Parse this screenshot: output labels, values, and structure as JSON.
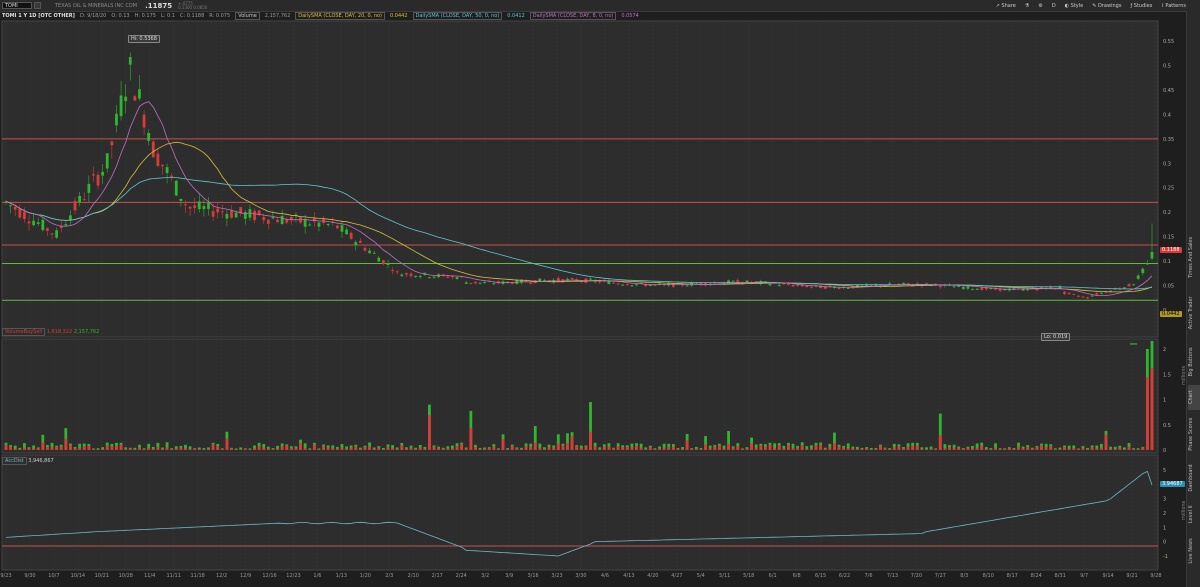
{
  "symbol": "TOMI",
  "company": "TEXAS OIL & MINERALS INC COM",
  "last_price": ".11875",
  "bid_ask": [
    "+.0775",
    "0.1300",
    "0.0850"
  ],
  "toolbar": {
    "share": "Share",
    "interval": "D",
    "style": "Style",
    "drawings": "Drawings",
    "studies": "Studies",
    "patterns": "Patterns"
  },
  "info": {
    "title": "TOMI 1 Y 1D [OTC OTHER]",
    "date": "D: 9/18/20",
    "open": "O: 0.13",
    "high": "H: 0.175",
    "low": "L: 0.1",
    "close": "C: 0.1188",
    "range": "R: 0.075",
    "volume_label": "Volume",
    "volume": "2,157,762",
    "sma20_label": "DailySMA (CLOSE, DAY, 20, 0, no)",
    "sma20": "0.0442",
    "sma50_label": "DailySMA (CLOSE, DAY, 50, 0, no)",
    "sma50": "0.0412",
    "sma8_label": "DailySMA (CLOSE, DAY, 8, 0, no)",
    "sma8": "0.0574"
  },
  "price_axis": {
    "ticks": [
      "0.55",
      "0.5",
      "0.45",
      "0.4",
      "0.35",
      "0.3",
      "0.25",
      "0.2",
      "0.15",
      "0.1",
      "0.05",
      "0"
    ],
    "hi_label": "Hi: 0.5368",
    "lo_label": "Lo: 0.019",
    "last_tag": "0.1188",
    "sma_tag": "0.0442"
  },
  "volume_panel": {
    "label": "VolumeBuySell",
    "sell": "1,618,322",
    "buy": "2,157,762",
    "ticks": [
      "2",
      "1.5",
      "1",
      "0.5",
      "0"
    ],
    "unit": "millions"
  },
  "accdist_panel": {
    "label": "AccDist",
    "value": "3,946,867",
    "ticks": [
      "5",
      "4",
      "3",
      "2",
      "1",
      "0",
      "-1"
    ],
    "unit": "millions",
    "tag": "3.94687"
  },
  "x_axis": [
    "9/23",
    "9/30",
    "10/7",
    "10/14",
    "10/21",
    "10/28",
    "11/4",
    "11/11",
    "11/18",
    "12/2",
    "12/9",
    "12/16",
    "12/23",
    "1/6",
    "1/13",
    "1/20",
    "2/3",
    "2/10",
    "2/17",
    "2/24",
    "3/2",
    "3/9",
    "3/16",
    "3/23",
    "3/30",
    "4/6",
    "4/13",
    "4/20",
    "4/27",
    "5/4",
    "5/11",
    "5/18",
    "6/1",
    "6/8",
    "6/15",
    "6/22",
    "7/6",
    "7/13",
    "7/20",
    "7/27",
    "8/3",
    "8/10",
    "8/17",
    "8/24",
    "8/31",
    "9/7",
    "9/14",
    "9/21",
    "9/28"
  ],
  "sidebar_tabs": [
    "Live News",
    "Level II",
    "Dashboard",
    "Phase Scores",
    "Chart",
    "Big Buttons",
    "Active Trader",
    "Times And Sales"
  ],
  "colors": {
    "up": "#2fb52f",
    "down": "#d93a3a",
    "sma20": "#d8c13a",
    "sma50": "#5fc6d0",
    "sma8": "#c070c0",
    "hline": "#c85050",
    "hgreen": "#5cbc3c",
    "accdist": "#6fb7c8"
  }
}
